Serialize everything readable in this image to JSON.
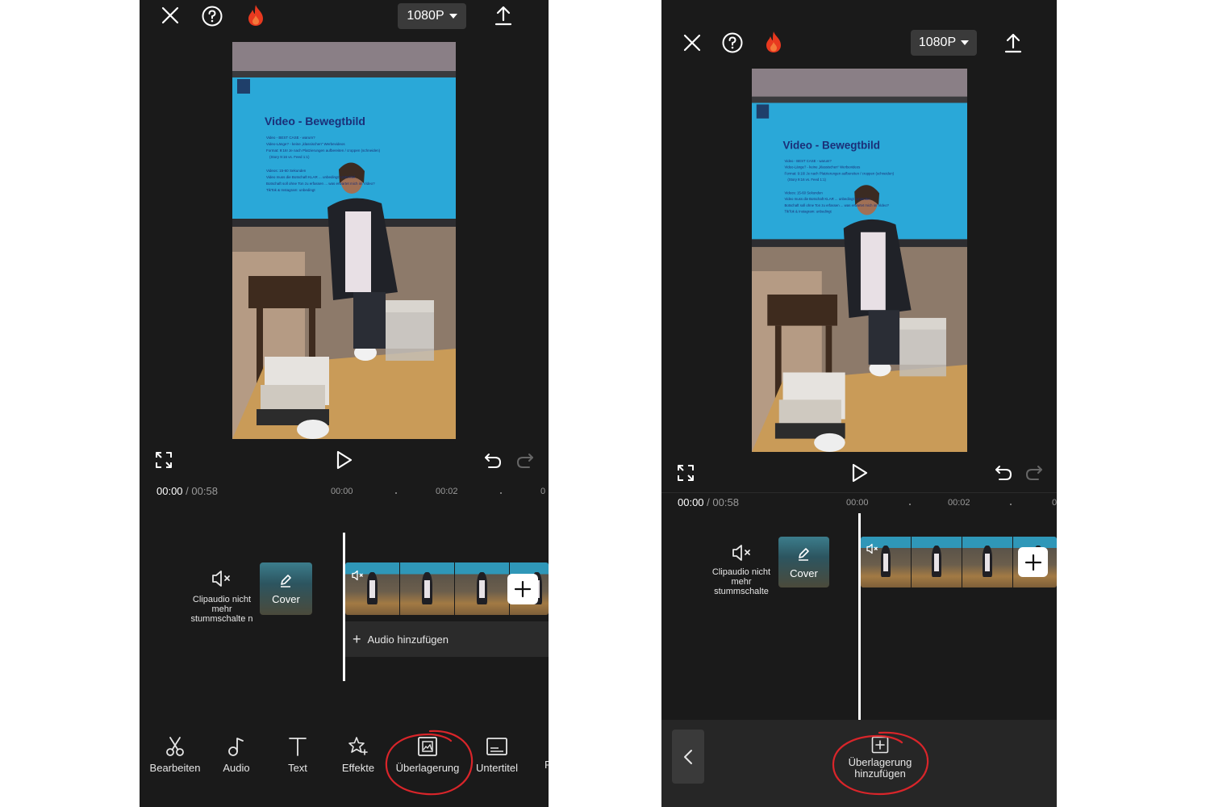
{
  "left": {
    "resolution": "1080P",
    "current_time": "00:00",
    "separator": "/",
    "total_time": "00:58",
    "ruler_ticks": [
      "00:00",
      "00:02"
    ],
    "mute_label": "Clipaudio nicht mehr stummschalte n",
    "cover_label": "Cover",
    "add_audio_label": "Audio hinzufügen",
    "toolbar": [
      "Bearbeiten",
      "Audio",
      "Text",
      "Effekte",
      "Überlagerung",
      "Untertitel"
    ]
  },
  "right": {
    "resolution": "1080P",
    "current_time": "00:00",
    "separator": "/",
    "total_time": "00:58",
    "ruler_ticks": [
      "00:00",
      "00:02"
    ],
    "mute_label": "Clipaudio nicht mehr stummschalte",
    "cover_label": "Cover",
    "add_overlay_label": "Überlagerung hinzufügen"
  },
  "slide": {
    "title": "Video - Bewegtbild",
    "bullets": [
      "Video - BEST CASE - warum?",
      "Video-Länge? - keine „klassischen“ Werbevideos",
      "Format: 9:16! Je nach Platzierungen aufbereiten / croppen (schneiden)",
      "(Story 9:16 vs. Feed 1:1)",
      "Videos: 15-60 Sekunden",
      "Video muss die Botschaft KLAR ... unbedingt: Untertitel",
      "Botschaft soll ohne Ton zu erfassen ... was erwartet mich im Video?",
      "TikTok & Instagram: unbedingt"
    ]
  },
  "colors": {
    "app_bg": "#1a1a1a",
    "accent_flame": "#e8391f",
    "annotation_red": "#d9252a",
    "slide_blue": "#2aa8d8"
  }
}
